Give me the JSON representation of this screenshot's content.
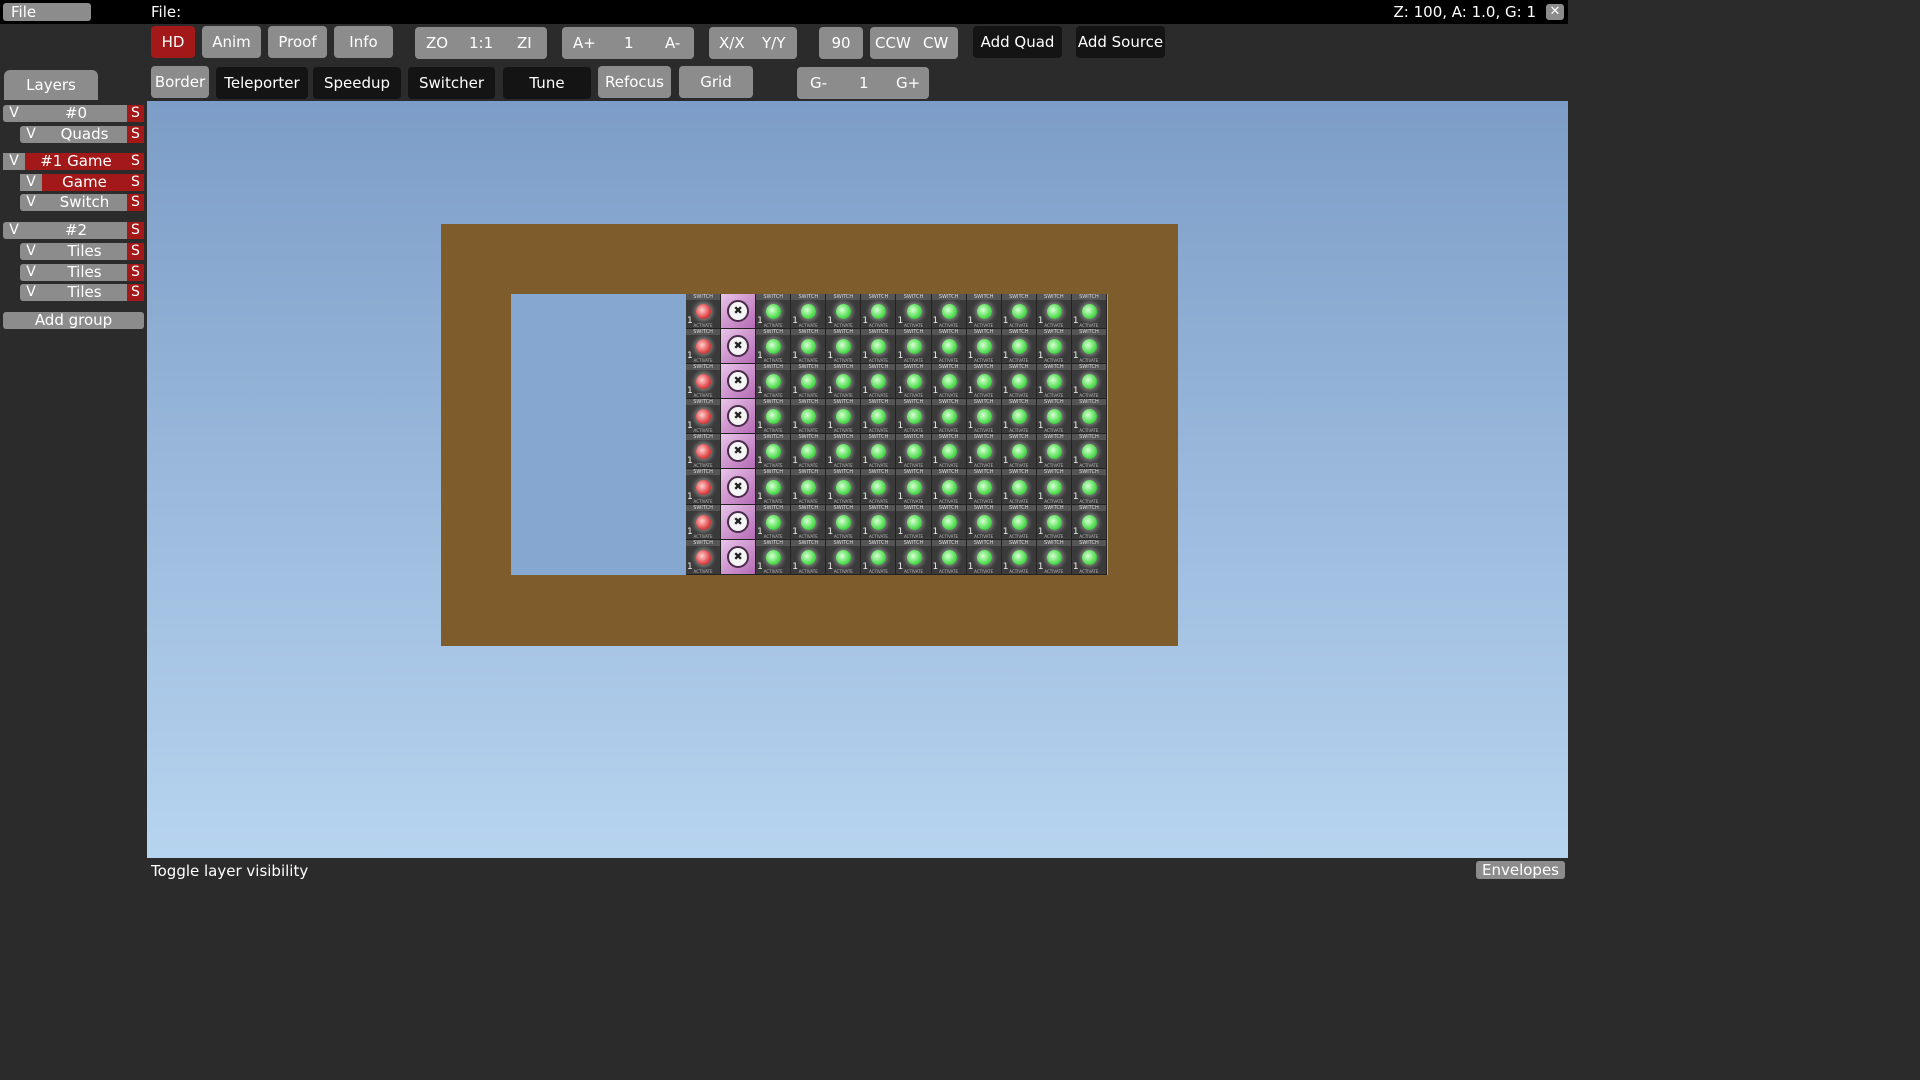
{
  "menu": {
    "file": "File",
    "file_path_label": "File:",
    "status": "Z: 100, A: 1.0, G: 1",
    "close": "✕"
  },
  "toolbar1": {
    "hd": "HD",
    "anim": "Anim",
    "proof": "Proof",
    "info": "Info",
    "zoom_out": "ZO",
    "zoom_reset": "1:1",
    "zoom_in": "ZI",
    "anim_plus": "A+",
    "anim_value": "1",
    "anim_minus": "A-",
    "flip_x": "X/X",
    "flip_y": "Y/Y",
    "rotate_value": "90",
    "ccw": "CCW",
    "cw": "CW",
    "add_quad": "Add Quad",
    "add_source": "Add Source"
  },
  "toolbar2": {
    "border": "Border",
    "teleporter": "Teleporter",
    "speedup": "Speedup",
    "switcher": "Switcher",
    "tune": "Tune",
    "refocus": "Refocus",
    "grid": "Grid",
    "grid_minus": "G-",
    "grid_value": "1",
    "grid_plus": "G+"
  },
  "sidebar": {
    "tab": "Layers",
    "groups": [
      {
        "name": "#0",
        "layers": [
          {
            "name": "Quads"
          }
        ]
      },
      {
        "name": "#1 Game",
        "layers": [
          {
            "name": "Game"
          },
          {
            "name": "Switch"
          }
        ]
      },
      {
        "name": "#2",
        "layers": [
          {
            "name": "Tiles"
          },
          {
            "name": "Tiles"
          },
          {
            "name": "Tiles"
          }
        ]
      }
    ],
    "visible_label": "V",
    "solo_label": "S",
    "add_group": "Add group"
  },
  "tiles": {
    "top_label": "SWITCH",
    "bottom_label": "ACTIVATE",
    "number": "1",
    "clock_glyph": "✖"
  },
  "statusbar": {
    "hint": "Toggle layer visibility",
    "envelopes": "Envelopes"
  },
  "colors": {
    "accent_red": "#a31818",
    "button_gray": "#8c8c8c",
    "border_brown": "#7e5c2c"
  }
}
